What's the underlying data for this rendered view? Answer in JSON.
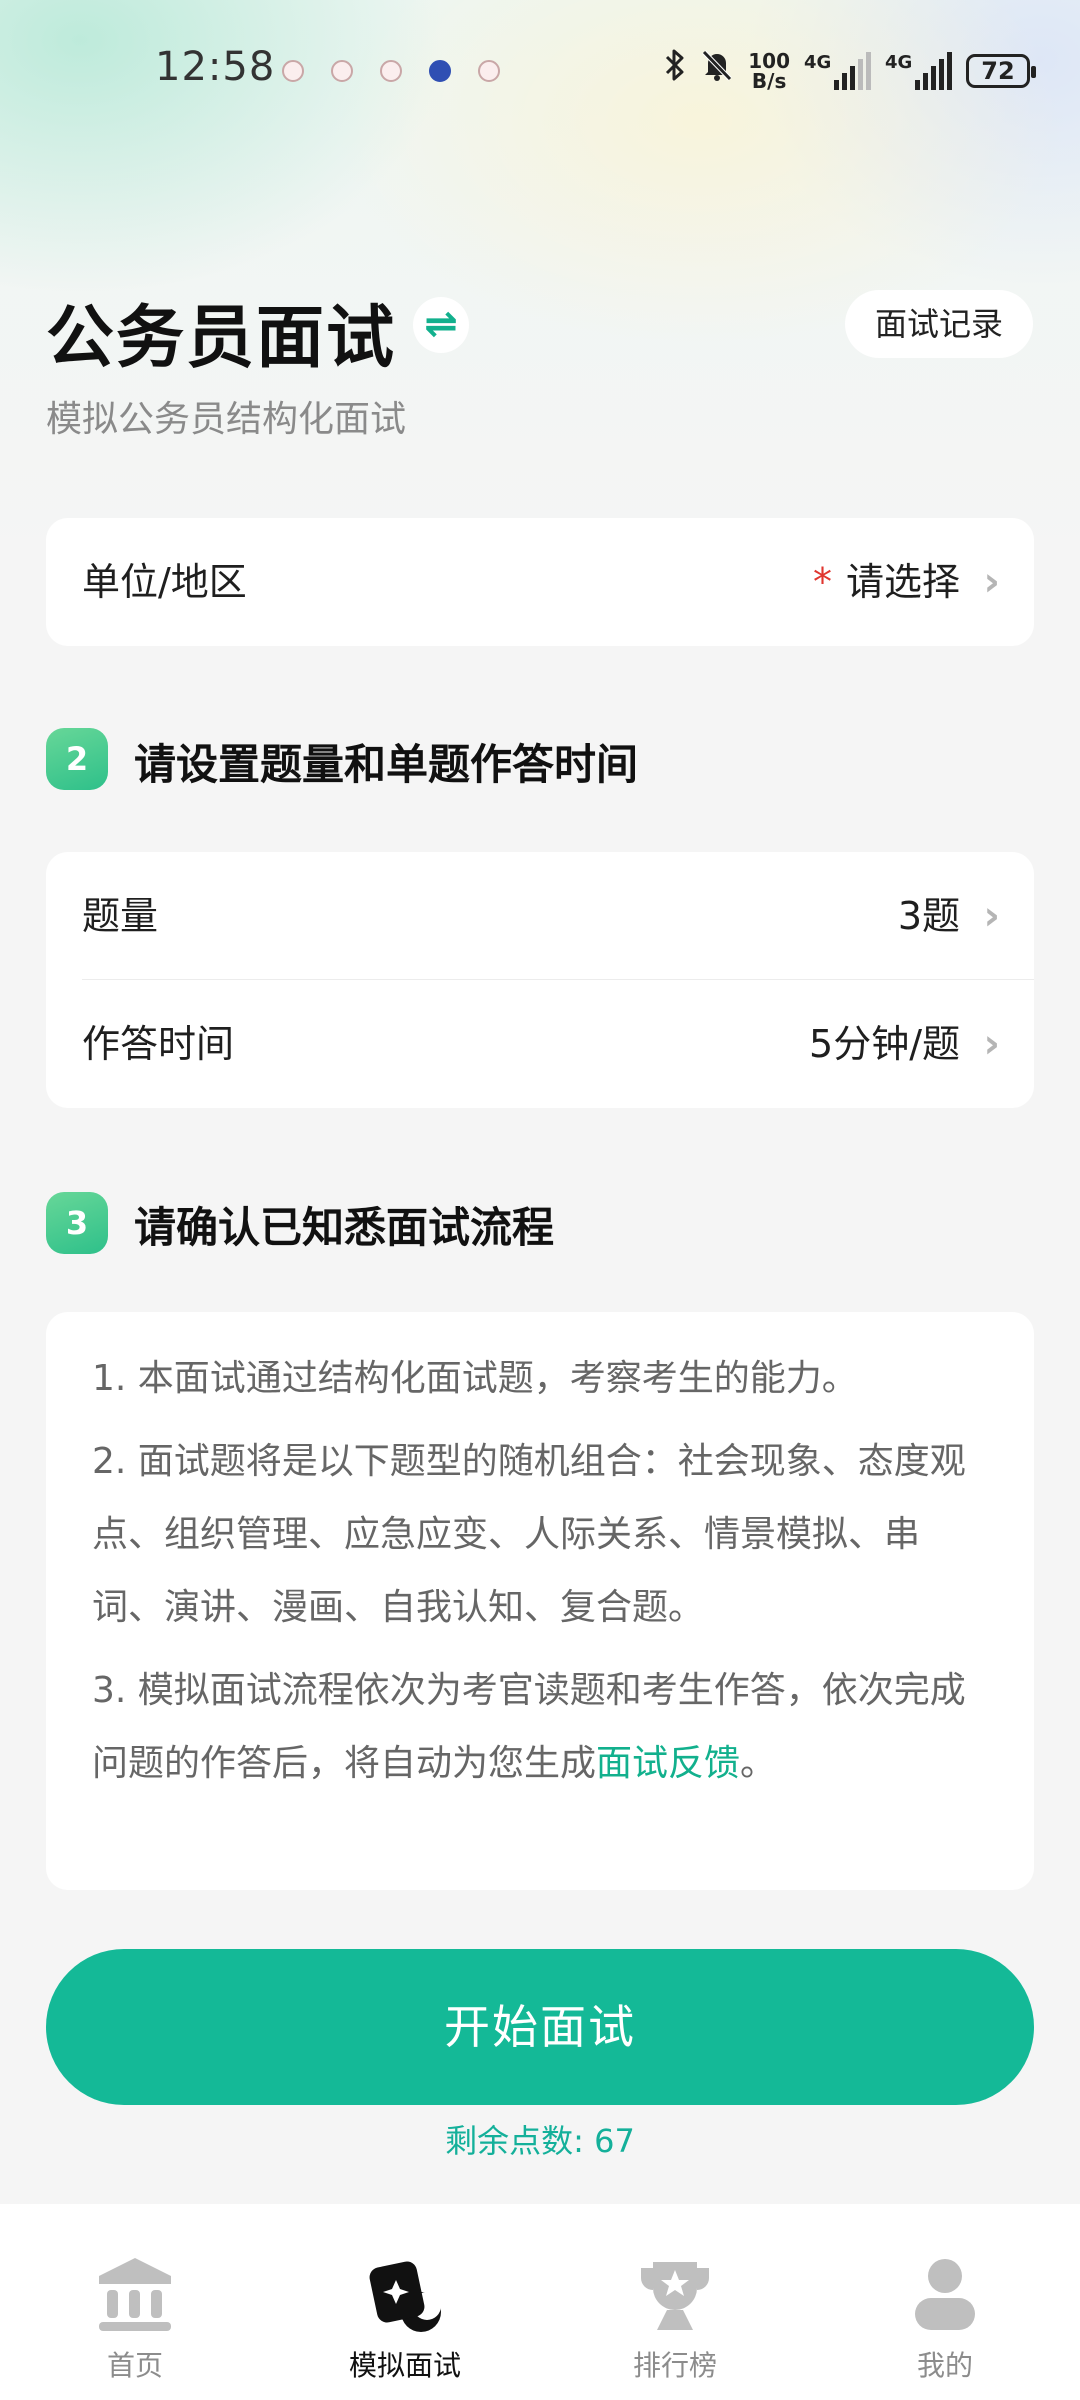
{
  "status_bar": {
    "time": "12:58",
    "net_speed_value": "100",
    "net_speed_unit": "B/s",
    "sim1_label": "4G",
    "sim2_label": "4G",
    "battery": "72"
  },
  "header": {
    "title": "公务员面试",
    "subtitle": "模拟公务员结构化面试",
    "record_button": "面试记录",
    "switch_icon": "⇌"
  },
  "unit_region": {
    "label": "单位/地区",
    "required_mark": "*",
    "value": "请选择"
  },
  "step2": {
    "number": "2",
    "title": "请设置题量和单题作答时间",
    "rows": [
      {
        "label": "题量",
        "value": "3题"
      },
      {
        "label": "作答时间",
        "value": "5分钟/题"
      }
    ]
  },
  "step3": {
    "number": "3",
    "title": "请确认已知悉面试流程",
    "p1": "1. 本面试通过结构化面试题，考察考生的能力。",
    "p2": "2. 面试题将是以下题型的随机组合：社会现象、态度观点、组织管理、应急应变、人际关系、情景模拟、串词、演讲、漫画、自我认知、复合题。",
    "p3_text": "3. 模拟面试流程依次为考官读题和考生作答，依次完成问题的作答后，将自动为您生成",
    "p3_link": "面试反馈",
    "p3_end": "。"
  },
  "start_button": "开始面试",
  "remaining": "剩余点数: 67",
  "colors": {
    "accent": "#14b997",
    "required": "#e0362f"
  },
  "tabbar": {
    "tabs": [
      {
        "label": "首页",
        "icon": "bank-icon",
        "active": false
      },
      {
        "label": "模拟面试",
        "icon": "interview-cards-icon",
        "active": true
      },
      {
        "label": "排行榜",
        "icon": "trophy-icon",
        "active": false
      },
      {
        "label": "我的",
        "icon": "user-icon",
        "active": false
      }
    ]
  }
}
